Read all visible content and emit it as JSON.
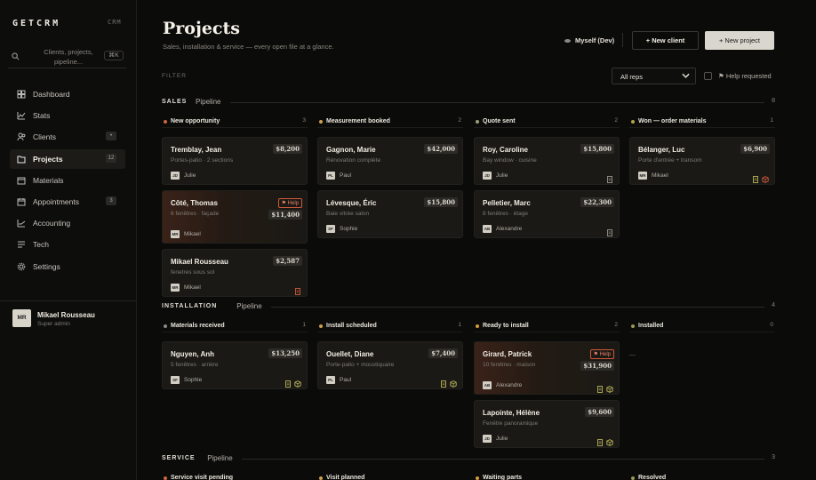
{
  "app": {
    "logo": "GETCRM",
    "logo_tag": "CRM"
  },
  "search": {
    "placeholder": "Clients, projects, pipeline...",
    "shortcut": "⌘K"
  },
  "sidebar": {
    "items": [
      {
        "label": "Dashboard",
        "icon": "grid-icon",
        "badge": ""
      },
      {
        "label": "Stats",
        "icon": "chart-icon",
        "badge": ""
      },
      {
        "label": "Clients",
        "icon": "users-icon",
        "badge": "•"
      },
      {
        "label": "Projects",
        "icon": "folder-icon",
        "badge": "12",
        "active": true
      },
      {
        "label": "Materials",
        "icon": "box-icon",
        "badge": ""
      },
      {
        "label": "Appointments",
        "icon": "calendar-icon",
        "badge": "3"
      },
      {
        "label": "Accounting",
        "icon": "ledger-icon",
        "badge": ""
      },
      {
        "label": "Tech",
        "icon": "wrench-icon",
        "badge": ""
      },
      {
        "label": "Settings",
        "icon": "gear-icon",
        "badge": ""
      }
    ]
  },
  "user": {
    "initials": "MR",
    "name": "Mikael Rousseau",
    "role": "Super admin"
  },
  "header": {
    "title": "Projects",
    "subtitle": "Sales, installation & service — every open file at a glance.",
    "view_as": "Myself (Dev)",
    "new_client": "New client",
    "new_project": "New project"
  },
  "filter": {
    "label": "FILTER",
    "reps_value": "All reps",
    "help_label": "Help requested"
  },
  "colors": {
    "accent_hot": "#d05a3c",
    "dot_red": "#d2663f",
    "dot_amber": "#c9a24a",
    "dot_olive": "#9a9a55",
    "dot_gray": "#8a8a8a"
  },
  "sections": [
    {
      "title": "SALES",
      "sub": "Pipeline",
      "count": "8",
      "columns": [
        {
          "title": "New opportunity",
          "count": "3",
          "dot": "#d2663f",
          "cards": [
            {
              "name": "Tremblay, Jean",
              "sub": "Portes-patio · 2 sections",
              "amount": "$8,200",
              "initials": "JD",
              "rep": "Julie",
              "help": "",
              "icons": []
            },
            {
              "name": "Côté, Thomas",
              "sub": "6 fenêtres · façade",
              "amount": "$11,400",
              "initials": "MR",
              "rep": "Mikael",
              "help": "Help",
              "icons": []
            },
            {
              "name": "Mikael Rousseau",
              "sub": "fenetres sous sol",
              "amount": "$2,587",
              "initials": "MR",
              "rep": "Mikael",
              "help": "",
              "icons": [
                "doc-red"
              ]
            }
          ]
        },
        {
          "title": "Measurement booked",
          "count": "2",
          "dot": "#c9a24a",
          "cards": [
            {
              "name": "Gagnon, Marie",
              "sub": "Rénovation complète",
              "amount": "$42,000",
              "initials": "PL",
              "rep": "Paul",
              "help": "",
              "icons": []
            },
            {
              "name": "Lévesque, Éric",
              "sub": "Baie vitrée salon",
              "amount": "$15,800",
              "initials": "SF",
              "rep": "Sophie",
              "help": "",
              "icons": []
            }
          ]
        },
        {
          "title": "Quote sent",
          "count": "2",
          "dot": "#9aa07a",
          "cards": [
            {
              "name": "Roy, Caroline",
              "sub": "Bay window · cuisine",
              "amount": "$15,800",
              "initials": "JD",
              "rep": "Julie",
              "help": "",
              "icons": [
                "doc"
              ]
            },
            {
              "name": "Pelletier, Marc",
              "sub": "8 fenêtres · étage",
              "amount": "$22,300",
              "initials": "AB",
              "rep": "Alexandre",
              "help": "",
              "icons": [
                "doc"
              ]
            }
          ]
        },
        {
          "title": "Won — order materials",
          "count": "1",
          "dot": "#b3a24a",
          "cards": [
            {
              "name": "Bélanger, Luc",
              "sub": "Porte d'entrée + transom",
              "amount": "$6,900",
              "initials": "MR",
              "rep": "Mikael",
              "help": "",
              "icons": [
                "doc-olive",
                "box-red"
              ]
            }
          ]
        }
      ]
    },
    {
      "title": "INSTALLATION",
      "sub": "Pipeline",
      "count": "4",
      "columns": [
        {
          "title": "Materials received",
          "count": "1",
          "dot": "#8a8a8a",
          "cards": [
            {
              "name": "Nguyen, Anh",
              "sub": "5 fenêtres · arrière",
              "amount": "$13,250",
              "initials": "SF",
              "rep": "Sophie",
              "help": "",
              "icons": [
                "doc-olive",
                "box-olive"
              ]
            }
          ]
        },
        {
          "title": "Install scheduled",
          "count": "1",
          "dot": "#c9a24a",
          "cards": [
            {
              "name": "Ouellet, Diane",
              "sub": "Porte-patio + moustiquaire",
              "amount": "$7,400",
              "initials": "PL",
              "rep": "Paul",
              "help": "",
              "icons": [
                "doc-olive",
                "box-olive"
              ]
            }
          ]
        },
        {
          "title": "Ready to install",
          "count": "2",
          "dot": "#d49a3f",
          "cards": [
            {
              "name": "Girard, Patrick",
              "sub": "10 fenêtres · maison",
              "amount": "$31,900",
              "initials": "AB",
              "rep": "Alexandre",
              "help": "Help",
              "icons": [
                "doc-olive",
                "box-olive"
              ]
            },
            {
              "name": "Lapointe, Hélène",
              "sub": "Fenêtre panoramique",
              "amount": "$9,600",
              "initials": "JD",
              "rep": "Julie",
              "help": "",
              "icons": [
                "doc-olive",
                "box-olive"
              ]
            }
          ]
        },
        {
          "title": "Installed",
          "count": "0",
          "dot": "#9a9a55",
          "cards": []
        }
      ]
    },
    {
      "title": "SERVICE",
      "sub": "Pipeline",
      "count": "3",
      "columns": [
        {
          "title": "Service visit pending",
          "count": "",
          "dot": "#d2663f",
          "cards": []
        },
        {
          "title": "Visit planned",
          "count": "",
          "dot": "#c9a24a",
          "cards": []
        },
        {
          "title": "Waiting parts",
          "count": "",
          "dot": "#d49a3f",
          "cards": []
        },
        {
          "title": "Resolved",
          "count": "",
          "dot": "#9a9a55",
          "cards": []
        }
      ]
    }
  ]
}
